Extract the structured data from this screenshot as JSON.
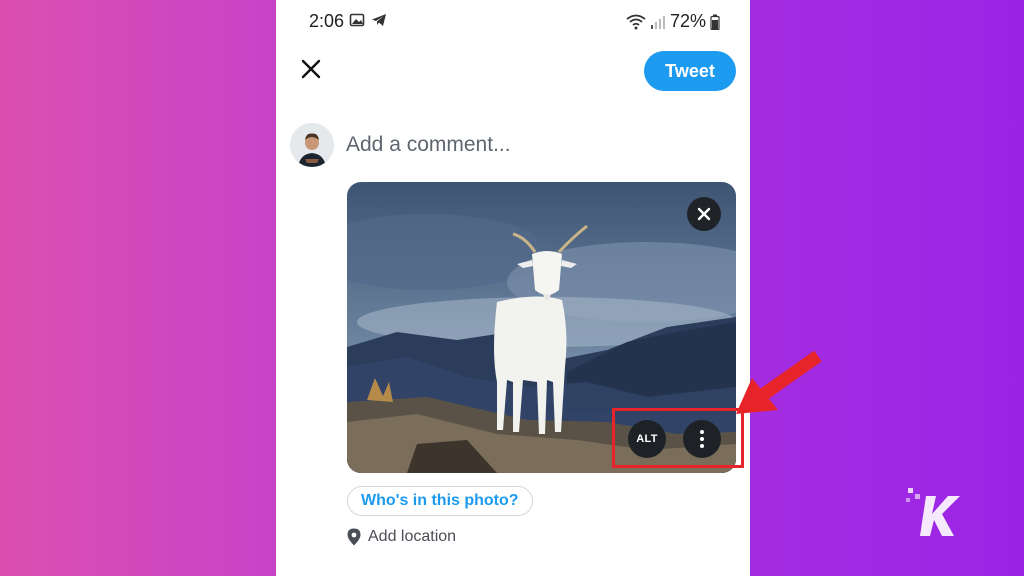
{
  "status_bar": {
    "time": "2:06",
    "battery": "72%",
    "icons": [
      "image-icon",
      "telegram-icon",
      "wifi-icon",
      "signal-icon",
      "battery-icon"
    ]
  },
  "header": {
    "close_icon": "close-icon",
    "tweet_label": "Tweet"
  },
  "composer": {
    "placeholder": "Add a comment...",
    "avatar_icon": "avatar"
  },
  "media": {
    "remove_icon": "close-icon",
    "alt_label": "ALT",
    "more_icon": "more-vertical-icon"
  },
  "actions": {
    "tag_label": "Who's in this photo?",
    "location_label": "Add location",
    "location_icon": "location-pin-icon"
  },
  "overlay": {
    "highlight_color": "#e8242b",
    "brand": "K"
  },
  "colors": {
    "accent": "#1d9bf0",
    "background_gradient_start": "#dc4fb0",
    "background_gradient_end": "#9a24e6"
  }
}
